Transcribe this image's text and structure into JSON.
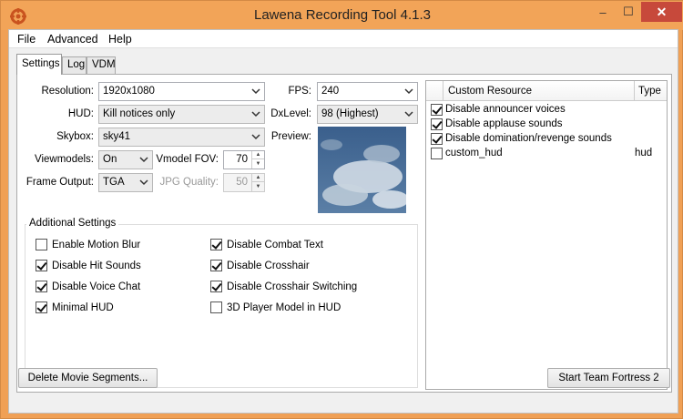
{
  "window": {
    "title": "Lawena Recording Tool 4.1.3",
    "controls": {
      "minimize": "–",
      "maximize": "☐",
      "close": "✕"
    }
  },
  "menu": [
    "File",
    "Advanced",
    "Help"
  ],
  "tabs": [
    "Settings",
    "Log",
    "VDM"
  ],
  "settings": {
    "resolution": {
      "label": "Resolution:",
      "value": "1920x1080"
    },
    "hud": {
      "label": "HUD:",
      "value": "Kill notices only"
    },
    "skybox": {
      "label": "Skybox:",
      "value": "sky41"
    },
    "viewmodels": {
      "label": "Viewmodels:",
      "value": "On"
    },
    "vmodel_fov": {
      "label": "Vmodel FOV:",
      "value": "70"
    },
    "frame_output": {
      "label": "Frame Output:",
      "value": "TGA"
    },
    "jpg_quality": {
      "label": "JPG Quality:",
      "value": "50"
    },
    "fps": {
      "label": "FPS:",
      "value": "240"
    },
    "dxlevel": {
      "label": "DxLevel:",
      "value": "98 (Highest)"
    },
    "preview": {
      "label": "Preview:"
    }
  },
  "additional": {
    "title": "Additional Settings",
    "items": [
      {
        "label": "Enable Motion Blur",
        "checked": false
      },
      {
        "label": "Disable Hit Sounds",
        "checked": true
      },
      {
        "label": "Disable Voice Chat",
        "checked": true
      },
      {
        "label": "Minimal HUD",
        "checked": true
      },
      {
        "label": "Disable Combat Text",
        "checked": true
      },
      {
        "label": "Disable Crosshair",
        "checked": true
      },
      {
        "label": "Disable Crosshair Switching",
        "checked": true
      },
      {
        "label": "3D Player Model in HUD",
        "checked": false
      }
    ]
  },
  "resources": {
    "headers": [
      "Custom Resource",
      "Type"
    ],
    "rows": [
      {
        "name": "Disable announcer voices",
        "type": "",
        "checked": true
      },
      {
        "name": "Disable applause sounds",
        "type": "",
        "checked": true
      },
      {
        "name": "Disable domination/revenge sounds",
        "type": "",
        "checked": true
      },
      {
        "name": "custom_hud",
        "type": "hud",
        "checked": false
      }
    ]
  },
  "buttons": {
    "delete_segments": "Delete Movie Segments...",
    "start_tf2": "Start Team Fortress 2"
  },
  "colors": {
    "frame": "#f2a458",
    "close": "#c7493b"
  }
}
